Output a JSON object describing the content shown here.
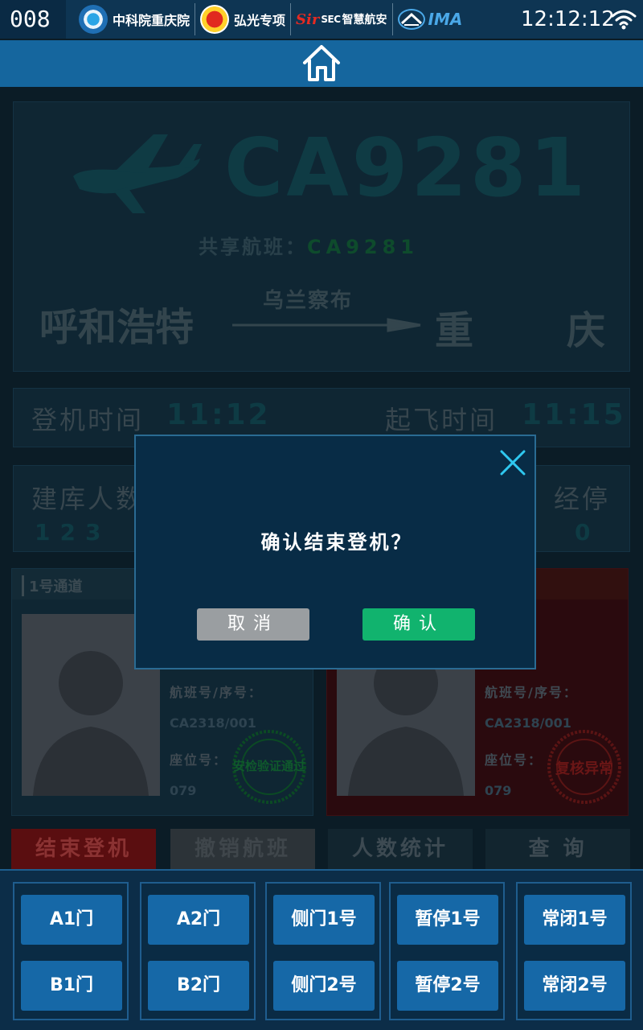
{
  "statusbar": {
    "device_id": "008",
    "logos": [
      {
        "icon": "cas-logo-icon",
        "label": "中科院重庆院"
      },
      {
        "icon": "hongguang-logo-icon",
        "label": "弘光专项"
      },
      {
        "icon": "sirsec-logo-icon",
        "label_prefix": "Sir",
        "label_mid": "SEC",
        "label": "智慧航安"
      },
      {
        "icon": "ima-logo-icon",
        "label": "IMA"
      }
    ],
    "clock": "12:12:12",
    "wifi_icon": "wifi-icon"
  },
  "navbar": {
    "home_icon": "home-icon"
  },
  "flight": {
    "number": "CA9281",
    "shared_label": "共享航班：",
    "shared_code": "CA9281",
    "from": "呼和浩特",
    "via": "乌兰察布",
    "to_part1": "重",
    "to_part2": "庆"
  },
  "times": {
    "boarding_label": "登机时间",
    "boarding_value": "11:12",
    "departure_label": "起飞时间",
    "departure_value": "11:15"
  },
  "counts": {
    "built_label": "建库人数",
    "built_value": "123",
    "paused_label": "经停",
    "paused_value": "0"
  },
  "channels": [
    {
      "title": "1号通道",
      "flight_seq_label": "航班号/序号：",
      "flight_seq_value": "CA2318/001",
      "seat_label": "座位号：",
      "seat_value": "079",
      "stamp_text": "安检验证通过"
    },
    {
      "flight_seq_label": "航班号/序号：",
      "flight_seq_value": "CA2318/001",
      "seat_label": "座位号：",
      "seat_value": "079",
      "stamp_text": "复核异常"
    }
  ],
  "actions": {
    "end_boarding": "结束登机",
    "cancel_flight": "撤销航班",
    "stats": "人数统计",
    "query": "查 询"
  },
  "dialog": {
    "message": "确认结束登机？",
    "cancel": "取消",
    "confirm": "确认"
  },
  "gates": [
    {
      "top": "A1门",
      "bottom": "B1门"
    },
    {
      "top": "A2门",
      "bottom": "B2门"
    },
    {
      "top": "侧门1号",
      "bottom": "侧门2号"
    },
    {
      "top": "暂停1号",
      "bottom": "暂停2号"
    },
    {
      "top": "常闭1号",
      "bottom": "常闭2号"
    }
  ],
  "colors": {
    "navbar": "#15669e",
    "confirm_green": "#11b36e",
    "cancel_gray": "#9a9ea1",
    "gate_button": "#1668a7"
  }
}
